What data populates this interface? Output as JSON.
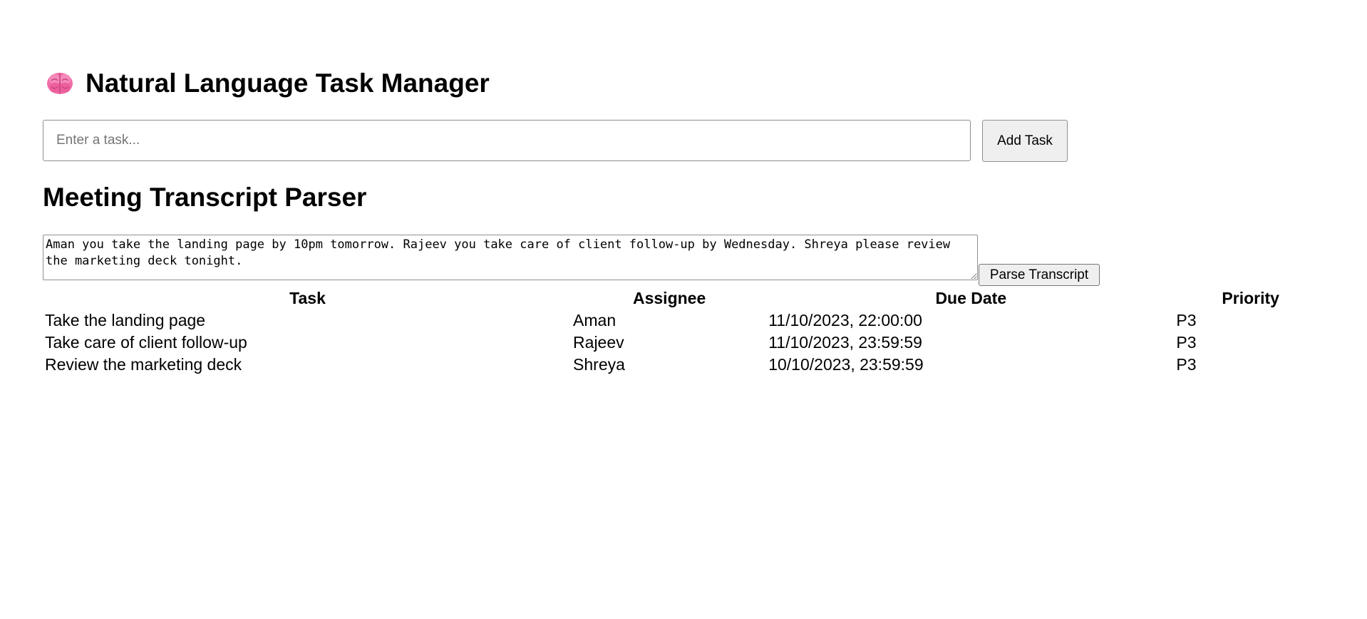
{
  "header": {
    "icon": "brain-icon",
    "title": "Natural Language Task Manager"
  },
  "task_entry": {
    "placeholder": "Enter a task...",
    "value": "",
    "add_button_label": "Add Task"
  },
  "transcript_parser": {
    "title": "Meeting Transcript Parser",
    "transcript_text": "Aman you take the landing page by 10pm tomorrow. Rajeev you take care of client follow-up by Wednesday. Shreya please review the marketing deck tonight.",
    "parse_button_label": "Parse Transcript"
  },
  "table": {
    "headers": {
      "task": "Task",
      "assignee": "Assignee",
      "due_date": "Due Date",
      "priority": "Priority"
    },
    "rows": [
      {
        "task": "Take the landing page",
        "assignee": "Aman",
        "due_date": "11/10/2023, 22:00:00",
        "priority": "P3"
      },
      {
        "task": "Take care of client follow-up",
        "assignee": "Rajeev",
        "due_date": "11/10/2023, 23:59:59",
        "priority": "P3"
      },
      {
        "task": "Review the marketing deck",
        "assignee": "Shreya",
        "due_date": "10/10/2023, 23:59:59",
        "priority": "P3"
      }
    ]
  },
  "colors": {
    "background": "#ffffff",
    "text": "#000000",
    "button_background": "#efefef",
    "border": "#8f8f8f",
    "brain_pink": "#f06fa8"
  }
}
